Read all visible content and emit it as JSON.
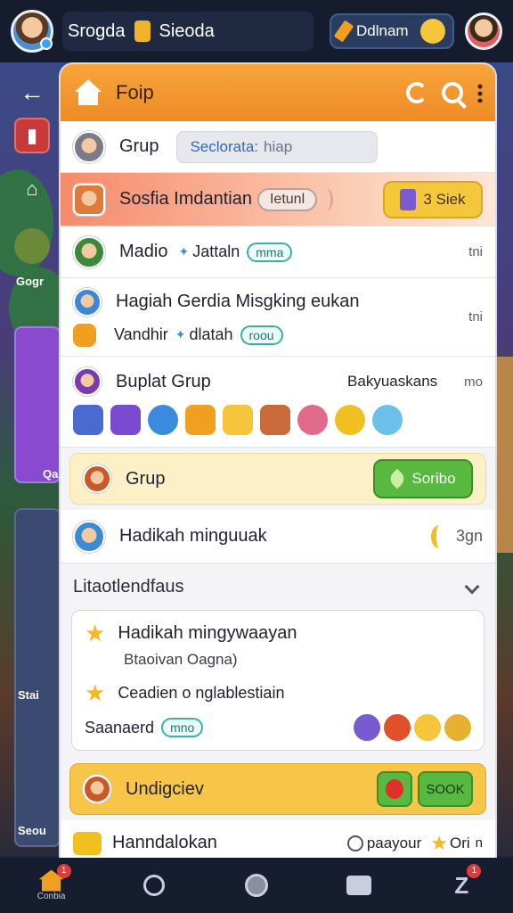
{
  "topbar": {
    "player_name": "Srogda",
    "currency_label": "Sieoda",
    "name_pill": "Ddlnam"
  },
  "side": {
    "label_1": "Gogr",
    "label_2": "Qa",
    "label_3": "Stai",
    "label_4": "Seou"
  },
  "panel": {
    "title": "Foip",
    "group_row": {
      "title": "Grup",
      "search_label": "Seclorata:",
      "search_placeholder": "hiap"
    },
    "banner": {
      "title": "Sosfia Imdantian",
      "pill": "Ietunl",
      "button": "3 Siek"
    },
    "row_madio": {
      "title": "Madio",
      "subtitle": "Jattaln",
      "tag": "mma",
      "meta": "tni"
    },
    "row_hagiah": {
      "title": "Hagiah Gerdia Misgking eukan",
      "subtitle": "Vandhir",
      "subtitle2": "dlatah",
      "tag": "roou",
      "meta": "tni"
    },
    "row_buplat": {
      "title": "Buplat Grup",
      "meta_right": "Bakyuaskans",
      "meta": "mo"
    },
    "row_grup": {
      "title": "Grup",
      "button": "Soribo"
    },
    "row_hadikah": {
      "title": "Hadikah minguuak",
      "meta": "3gn"
    },
    "section": {
      "title": "Litaotlendfaus"
    },
    "card": {
      "line1": "Hadikah mingywaayan",
      "line1_sub": "Btaoivan Oagna)",
      "line2": "Ceadien o nglablestiain",
      "line3": "Saanaerd",
      "line3_tag": "mno"
    },
    "row_undig": {
      "title": "Undigciev",
      "button": "SOOK"
    },
    "row_hann": {
      "title": "Hanndalokan",
      "meta1": "paayour",
      "meta2": "Ori",
      "meta3": "n"
    }
  },
  "bottom": {
    "home_label": "Conbia",
    "home_badge": "1",
    "profile_badge": "1"
  },
  "colors": {
    "header_orange": "#ef8a24",
    "green_button": "#58b840",
    "gold_button": "#f4c83a",
    "tag_teal": "#3ab0a8"
  }
}
